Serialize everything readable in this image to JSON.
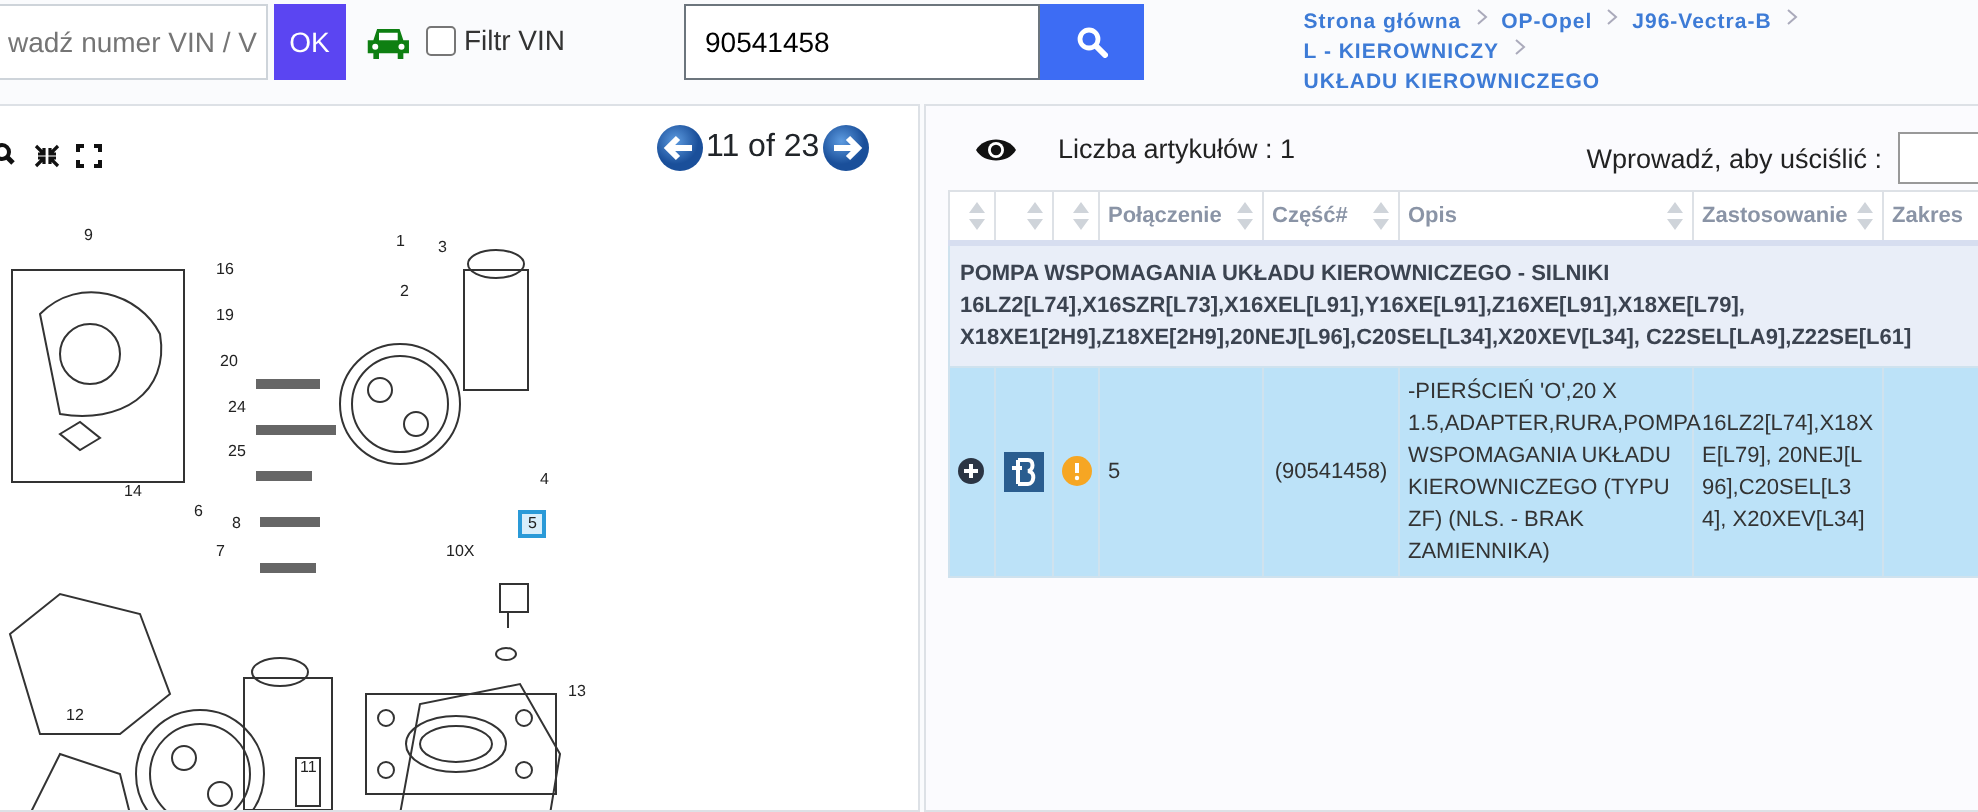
{
  "vin_search": {
    "placeholder": "wadź numer VIN / V",
    "button": "OK"
  },
  "vin_filter": {
    "label": "Filtr VIN",
    "checked": false
  },
  "part_search": {
    "value": "90541458"
  },
  "breadcrumb": [
    {
      "label": "Strona główna"
    },
    {
      "label": "OP-Opel"
    },
    {
      "label": "J96-Vectra-B"
    },
    {
      "label": "L - KIEROWNICZY"
    },
    {
      "label": "UKŁADU KIEROWNICZEGO"
    }
  ],
  "diagram": {
    "pager": "11 of 23",
    "callouts": [
      {
        "label": "9",
        "selected": false
      },
      {
        "label": "16",
        "selected": false
      },
      {
        "label": "19",
        "selected": false
      },
      {
        "label": "20",
        "selected": false
      },
      {
        "label": "24",
        "selected": false
      },
      {
        "label": "25",
        "selected": false
      },
      {
        "label": "1",
        "selected": false
      },
      {
        "label": "3",
        "selected": false
      },
      {
        "label": "2",
        "selected": false
      },
      {
        "label": "4",
        "selected": false
      },
      {
        "label": "5",
        "selected": true
      },
      {
        "label": "10X",
        "selected": false
      },
      {
        "label": "14",
        "selected": false
      },
      {
        "label": "6",
        "selected": false
      },
      {
        "label": "8",
        "selected": false
      },
      {
        "label": "7",
        "selected": false
      },
      {
        "label": "12",
        "selected": false
      },
      {
        "label": "11",
        "selected": false
      },
      {
        "label": "13",
        "selected": false
      }
    ]
  },
  "articles": {
    "count_label": "Liczba artykułów : 1",
    "filter_label": "Wprowadź, aby uściślić :"
  },
  "table": {
    "columns": [
      "Połączenie",
      "Część#",
      "Opis",
      "Zastosowanie",
      "Zakres"
    ],
    "group": "POMPA WSPOMAGANIA UKŁADU KIEROWNICZEGO - SILNIKI 16LZ2[L74],X16SZR[L73],X16XEL[L91],Y16XE[L91],Z16XE[L91],X18XE[L79], X18XE1[2H9],Z18XE[2H9],20NEJ[L96],C20SEL[L34],X20XEV[L34], C22SEL[LA9],Z22SE[L61]",
    "rows": [
      {
        "selected": true,
        "connection": "5",
        "part": "(90541458)",
        "description": "-PIERŚCIEŃ 'O',20 X 1.5,ADAPTER,RURA,POMPA WSPOMAGANIA UKŁADU KIEROWNICZEGO (TYPU ZF) (NLS. - BRAK ZAMIENNIKA)",
        "application": "16LZ2[L74],X18XE[L79], 20NEJ[L96],C20SEL[L34], X20XEV[L34]"
      }
    ]
  }
}
